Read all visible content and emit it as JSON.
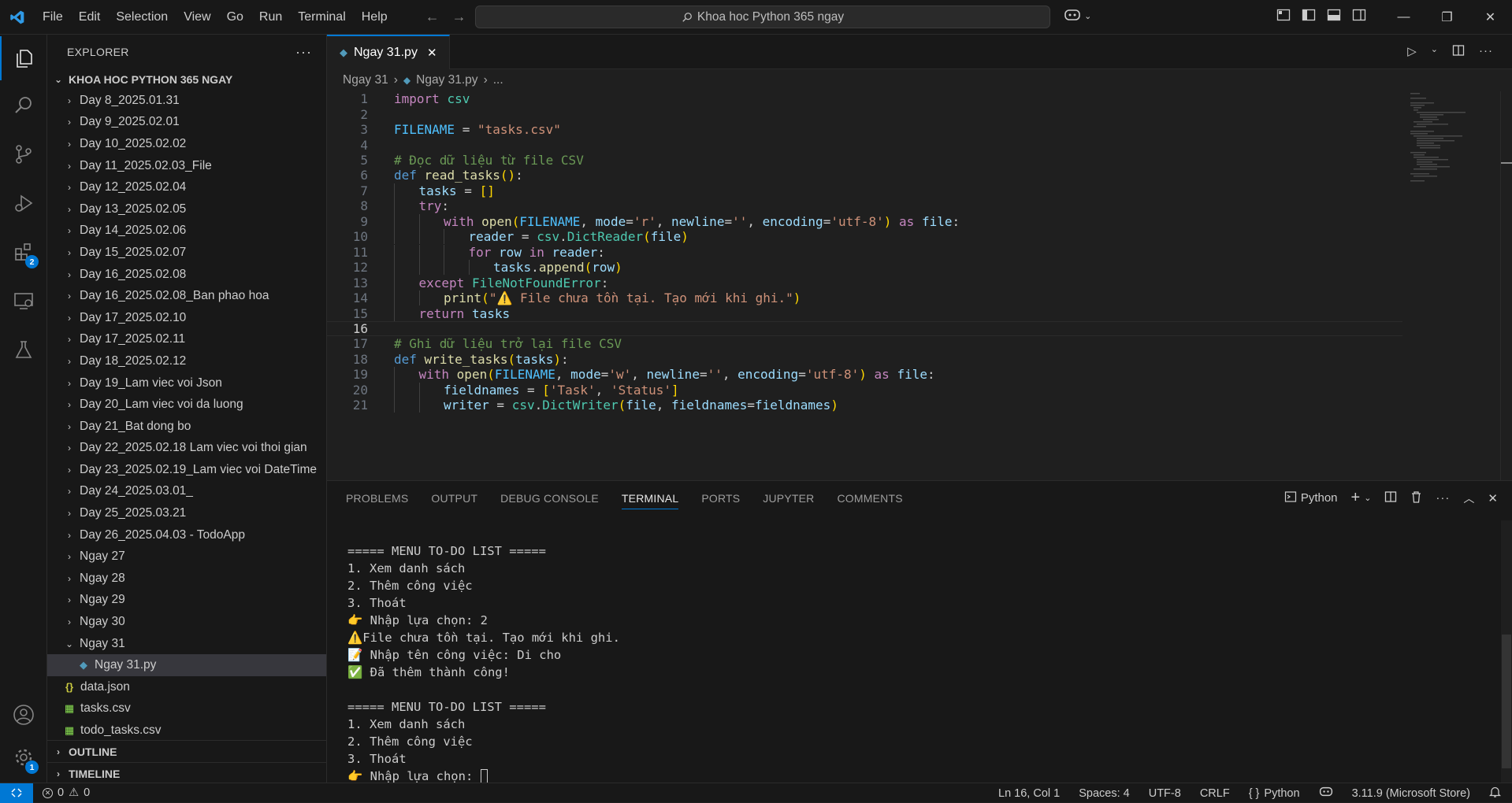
{
  "titlebar": {
    "menu": [
      "File",
      "Edit",
      "Selection",
      "View",
      "Go",
      "Run",
      "Terminal",
      "Help"
    ],
    "search_text": "Khoa hoc Python 365 ngay"
  },
  "activity": {
    "extensions_badge": "2",
    "accounts_badge": "1"
  },
  "sidebar": {
    "title": "EXPLORER",
    "root": "KHOA HOC PYTHON 365 NGAY",
    "folders": [
      "Day 8_2025.01.31",
      "Day 9_2025.02.01",
      "Day 10_2025.02.02",
      "Day 11_2025.02.03_File",
      "Day 12_2025.02.04",
      "Day 13_2025.02.05",
      "Day 14_2025.02.06",
      "Day 15_2025.02.07",
      "Day 16_2025.02.08",
      "Day 16_2025.02.08_Ban phao hoa",
      "Day 17_2025.02.10",
      "Day 17_2025.02.11",
      "Day 18_2025.02.12",
      "Day 19_Lam viec voi Json",
      "Day 20_Lam viec voi da luong",
      "Day 21_Bat dong bo",
      "Day 22_2025.02.18 Lam viec voi thoi gian",
      "Day 23_2025.02.19_Lam viec voi DateTime",
      "Day 24_2025.03.01_",
      "Day 25_2025.03.21",
      "Day 26_2025.04.03 - TodoApp",
      "Ngay 27",
      "Ngay 28",
      "Ngay 29",
      "Ngay 30"
    ],
    "open_folder": "Ngay 31",
    "open_file": "Ngay 31.py",
    "files": [
      {
        "name": "data.json",
        "icon": "{}",
        "color": "#cbcb41"
      },
      {
        "name": "tasks.csv",
        "icon": "▦",
        "color": "#89e051"
      },
      {
        "name": "todo_tasks.csv",
        "icon": "▦",
        "color": "#89e051"
      }
    ],
    "outline": "OUTLINE",
    "timeline": "TIMELINE"
  },
  "editor": {
    "tab_label": "Ngay 31.py",
    "breadcrumb": [
      "Ngay 31",
      "Ngay 31.py",
      "..."
    ],
    "current_line": "16",
    "lines": [
      {
        "n": "1",
        "indent": 0,
        "tokens": [
          [
            "kw",
            "import"
          ],
          [
            "plain",
            " "
          ],
          [
            "cls",
            "csv"
          ]
        ]
      },
      {
        "n": "2",
        "indent": 0,
        "tokens": []
      },
      {
        "n": "3",
        "indent": 0,
        "tokens": [
          [
            "const",
            "FILENAME"
          ],
          [
            "plain",
            " = "
          ],
          [
            "str",
            "\"tasks.csv\""
          ]
        ]
      },
      {
        "n": "4",
        "indent": 0,
        "tokens": []
      },
      {
        "n": "5",
        "indent": 0,
        "tokens": [
          [
            "com",
            "# Đọc dữ liệu từ file CSV"
          ]
        ]
      },
      {
        "n": "6",
        "indent": 0,
        "tokens": [
          [
            "kw2",
            "def"
          ],
          [
            "plain",
            " "
          ],
          [
            "fn",
            "read_tasks"
          ],
          [
            "br1",
            "()"
          ],
          [
            "plain",
            ":"
          ]
        ]
      },
      {
        "n": "7",
        "indent": 1,
        "tokens": [
          [
            "var",
            "tasks"
          ],
          [
            "plain",
            " = "
          ],
          [
            "br1",
            "[]"
          ]
        ]
      },
      {
        "n": "8",
        "indent": 1,
        "tokens": [
          [
            "kw",
            "try"
          ],
          [
            "plain",
            ":"
          ]
        ]
      },
      {
        "n": "9",
        "indent": 2,
        "tokens": [
          [
            "kw",
            "with"
          ],
          [
            "plain",
            " "
          ],
          [
            "fn",
            "open"
          ],
          [
            "br1",
            "("
          ],
          [
            "const",
            "FILENAME"
          ],
          [
            "plain",
            ", "
          ],
          [
            "var",
            "mode"
          ],
          [
            "plain",
            "="
          ],
          [
            "str",
            "'r'"
          ],
          [
            "plain",
            ", "
          ],
          [
            "var",
            "newline"
          ],
          [
            "plain",
            "="
          ],
          [
            "str",
            "''"
          ],
          [
            "plain",
            ", "
          ],
          [
            "var",
            "encoding"
          ],
          [
            "plain",
            "="
          ],
          [
            "str",
            "'utf-8'"
          ],
          [
            "br1",
            ")"
          ],
          [
            "plain",
            " "
          ],
          [
            "kw",
            "as"
          ],
          [
            "plain",
            " "
          ],
          [
            "var",
            "file"
          ],
          [
            "plain",
            ":"
          ]
        ]
      },
      {
        "n": "10",
        "indent": 3,
        "tokens": [
          [
            "var",
            "reader"
          ],
          [
            "plain",
            " = "
          ],
          [
            "cls",
            "csv"
          ],
          [
            "plain",
            "."
          ],
          [
            "cls",
            "DictReader"
          ],
          [
            "br1",
            "("
          ],
          [
            "var",
            "file"
          ],
          [
            "br1",
            ")"
          ]
        ]
      },
      {
        "n": "11",
        "indent": 3,
        "tokens": [
          [
            "kw",
            "for"
          ],
          [
            "plain",
            " "
          ],
          [
            "var",
            "row"
          ],
          [
            "plain",
            " "
          ],
          [
            "kw",
            "in"
          ],
          [
            "plain",
            " "
          ],
          [
            "var",
            "reader"
          ],
          [
            "plain",
            ":"
          ]
        ]
      },
      {
        "n": "12",
        "indent": 4,
        "tokens": [
          [
            "var",
            "tasks"
          ],
          [
            "plain",
            "."
          ],
          [
            "fn",
            "append"
          ],
          [
            "br1",
            "("
          ],
          [
            "var",
            "row"
          ],
          [
            "br1",
            ")"
          ]
        ]
      },
      {
        "n": "13",
        "indent": 1,
        "tokens": [
          [
            "kw",
            "except"
          ],
          [
            "plain",
            " "
          ],
          [
            "cls",
            "FileNotFoundError"
          ],
          [
            "plain",
            ":"
          ]
        ]
      },
      {
        "n": "14",
        "indent": 2,
        "tokens": [
          [
            "fn",
            "print"
          ],
          [
            "br1",
            "("
          ],
          [
            "str",
            "\"⚠️ File chưa tồn tại. Tạo mới khi ghi.\""
          ],
          [
            "br1",
            ")"
          ]
        ]
      },
      {
        "n": "15",
        "indent": 1,
        "tokens": [
          [
            "kw",
            "return"
          ],
          [
            "plain",
            " "
          ],
          [
            "var",
            "tasks"
          ]
        ]
      },
      {
        "n": "16",
        "indent": 0,
        "tokens": []
      },
      {
        "n": "17",
        "indent": 0,
        "tokens": [
          [
            "com",
            "# Ghi dữ liệu trở lại file CSV"
          ]
        ]
      },
      {
        "n": "18",
        "indent": 0,
        "tokens": [
          [
            "kw2",
            "def"
          ],
          [
            "plain",
            " "
          ],
          [
            "fn",
            "write_tasks"
          ],
          [
            "br1",
            "("
          ],
          [
            "var",
            "tasks"
          ],
          [
            "br1",
            ")"
          ],
          [
            "plain",
            ":"
          ]
        ]
      },
      {
        "n": "19",
        "indent": 1,
        "tokens": [
          [
            "kw",
            "with"
          ],
          [
            "plain",
            " "
          ],
          [
            "fn",
            "open"
          ],
          [
            "br1",
            "("
          ],
          [
            "const",
            "FILENAME"
          ],
          [
            "plain",
            ", "
          ],
          [
            "var",
            "mode"
          ],
          [
            "plain",
            "="
          ],
          [
            "str",
            "'w'"
          ],
          [
            "plain",
            ", "
          ],
          [
            "var",
            "newline"
          ],
          [
            "plain",
            "="
          ],
          [
            "str",
            "''"
          ],
          [
            "plain",
            ", "
          ],
          [
            "var",
            "encoding"
          ],
          [
            "plain",
            "="
          ],
          [
            "str",
            "'utf-8'"
          ],
          [
            "br1",
            ")"
          ],
          [
            "plain",
            " "
          ],
          [
            "kw",
            "as"
          ],
          [
            "plain",
            " "
          ],
          [
            "var",
            "file"
          ],
          [
            "plain",
            ":"
          ]
        ]
      },
      {
        "n": "20",
        "indent": 2,
        "tokens": [
          [
            "var",
            "fieldnames"
          ],
          [
            "plain",
            " = "
          ],
          [
            "br1",
            "["
          ],
          [
            "str",
            "'Task'"
          ],
          [
            "plain",
            ", "
          ],
          [
            "str",
            "'Status'"
          ],
          [
            "br1",
            "]"
          ]
        ]
      },
      {
        "n": "21",
        "indent": 2,
        "tokens": [
          [
            "var",
            "writer"
          ],
          [
            "plain",
            " = "
          ],
          [
            "cls",
            "csv"
          ],
          [
            "plain",
            "."
          ],
          [
            "cls",
            "DictWriter"
          ],
          [
            "br1",
            "("
          ],
          [
            "var",
            "file"
          ],
          [
            "plain",
            ", "
          ],
          [
            "var",
            "fieldnames"
          ],
          [
            "plain",
            "="
          ],
          [
            "var",
            "fieldnames"
          ],
          [
            "br1",
            ")"
          ]
        ]
      }
    ]
  },
  "panel": {
    "tabs": [
      "PROBLEMS",
      "OUTPUT",
      "DEBUG CONSOLE",
      "TERMINAL",
      "PORTS",
      "JUPYTER",
      "COMMENTS"
    ],
    "active_tab": "TERMINAL",
    "shell_label": "Python",
    "terminal_lines": [
      "",
      "===== MENU TO-DO LIST =====",
      "1. Xem danh sách",
      "2. Thêm công việc",
      "3. Thoát",
      "👉 Nhập lựa chọn: 2",
      "⚠️File chưa tồn tại. Tạo mới khi ghi.",
      "📝 Nhập tên công việc: Di cho",
      "✅ Đã thêm thành công!",
      "",
      "===== MENU TO-DO LIST =====",
      "1. Xem danh sách",
      "2. Thêm công việc",
      "3. Thoát"
    ],
    "prompt_line": "👉 Nhập lựa chọn: "
  },
  "statusbar": {
    "errors": "0",
    "warnings": "0",
    "position": "Ln 16, Col 1",
    "spaces": "Spaces: 4",
    "encoding": "UTF-8",
    "eol": "CRLF",
    "language": "Python",
    "interpreter": "3.11.9 (Microsoft Store)"
  }
}
